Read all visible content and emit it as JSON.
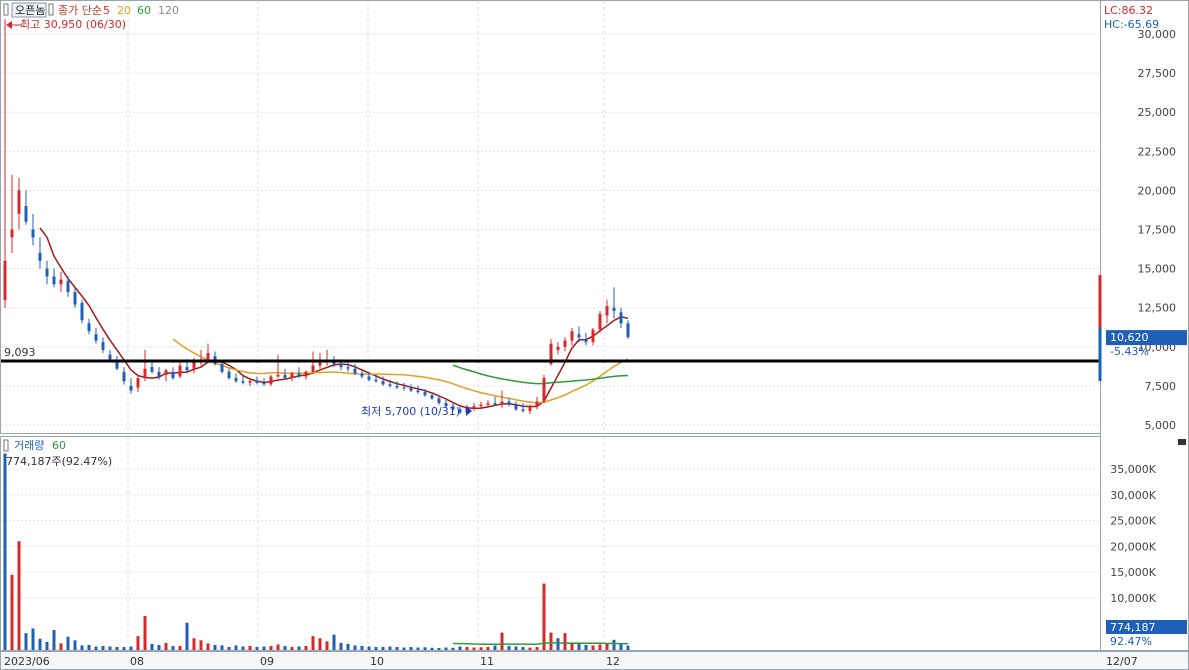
{
  "header": {
    "open_button": "오픈놈",
    "ma_label": "종가 단순",
    "ma_periods": [
      {
        "label": "5",
        "color": "#c0392b"
      },
      {
        "label": "20",
        "color": "#e0a020"
      },
      {
        "label": "60",
        "color": "#2e9b3a"
      },
      {
        "label": "120",
        "color": "#888888"
      }
    ],
    "lc": "LC:86.32",
    "hc": "HC:-65.69"
  },
  "annotations": {
    "high": "최고 30,950 (06/30)",
    "low": "최저 5,700 (10/31)",
    "hline_label": "9,093",
    "current_price": "10,620",
    "current_change": "-5.43%",
    "volume_title": "거래량",
    "volume_ma": "60",
    "volume_info": "774,187주(92.47%)",
    "volume_current": "774,187",
    "volume_pct": "92.47%",
    "date_label": "12/07"
  },
  "colors": {
    "up": "#d42a2a",
    "down": "#1e5fb8",
    "ma5": "#a01818",
    "ma20": "#e0a020",
    "ma60": "#2e9b3a",
    "hline": "#000000",
    "grid": "#dde3ea"
  },
  "chart_data": [
    {
      "type": "candlestick",
      "ylim": [
        4000,
        31000
      ],
      "yticks": [
        "5,000",
        "7,500",
        "10,000",
        "12,500",
        "15,000",
        "17,500",
        "20,000",
        "22,500",
        "25,000",
        "27,500",
        "30,000"
      ],
      "xticks": [
        "2023/06",
        "08",
        "09",
        "10",
        "11",
        "12"
      ],
      "hline": 9093,
      "ohlc": [
        [
          13000,
          30950,
          12500,
          15500
        ],
        [
          17000,
          21000,
          16000,
          17500
        ],
        [
          18500,
          20800,
          17500,
          20000
        ],
        [
          19000,
          20000,
          17800,
          18000
        ],
        [
          17500,
          18500,
          16500,
          17000
        ],
        [
          16000,
          17000,
          15000,
          15500
        ],
        [
          15000,
          15500,
          14000,
          14500
        ],
        [
          14500,
          15000,
          13800,
          14000
        ],
        [
          14000,
          14800,
          13500,
          14300
        ],
        [
          14200,
          14500,
          13200,
          13500
        ],
        [
          13500,
          13800,
          12500,
          12700
        ],
        [
          12800,
          13000,
          11500,
          11700
        ],
        [
          11500,
          11800,
          10800,
          11000
        ],
        [
          10800,
          11200,
          10200,
          10400
        ],
        [
          10300,
          10600,
          9600,
          9800
        ],
        [
          9500,
          9800,
          9000,
          9200
        ],
        [
          9100,
          9400,
          8500,
          8600
        ],
        [
          8400,
          8700,
          7600,
          7800
        ],
        [
          7500,
          8000,
          7000,
          7200
        ],
        [
          7400,
          8200,
          7100,
          8000
        ],
        [
          8000,
          9800,
          7800,
          8600
        ],
        [
          8700,
          9000,
          8300,
          8400
        ],
        [
          8400,
          8700,
          7900,
          8100
        ],
        [
          8200,
          8600,
          7800,
          8500
        ],
        [
          8400,
          8700,
          7900,
          8000
        ],
        [
          8100,
          9000,
          8000,
          8800
        ],
        [
          8700,
          9200,
          8400,
          8500
        ],
        [
          8600,
          9300,
          8300,
          9000
        ],
        [
          9000,
          9800,
          8800,
          9200
        ],
        [
          9200,
          10200,
          9000,
          9600
        ],
        [
          9400,
          9700,
          8800,
          8900
        ],
        [
          8900,
          9100,
          8300,
          8400
        ],
        [
          8400,
          8600,
          7900,
          8000
        ],
        [
          8000,
          8300,
          7700,
          7800
        ],
        [
          7800,
          8100,
          7600,
          7700
        ],
        [
          7700,
          8000,
          7500,
          7800
        ],
        [
          7800,
          8100,
          7600,
          7700
        ],
        [
          7700,
          8000,
          7500,
          7600
        ],
        [
          7600,
          8200,
          7500,
          8100
        ],
        [
          8100,
          9500,
          8000,
          8200
        ],
        [
          8200,
          8600,
          7900,
          8000
        ],
        [
          8000,
          8400,
          7800,
          8300
        ],
        [
          8300,
          8700,
          8000,
          8100
        ],
        [
          8100,
          8500,
          7900,
          8400
        ],
        [
          8400,
          9700,
          8300,
          8800
        ],
        [
          8800,
          9600,
          8600,
          9000
        ],
        [
          9000,
          9800,
          8800,
          9100
        ],
        [
          9100,
          9400,
          8700,
          8900
        ],
        [
          8900,
          9200,
          8500,
          8700
        ],
        [
          8700,
          9000,
          8400,
          8600
        ],
        [
          8600,
          8900,
          8200,
          8300
        ],
        [
          8300,
          8600,
          8000,
          8100
        ],
        [
          8100,
          8400,
          7800,
          7900
        ],
        [
          7900,
          8200,
          7700,
          7800
        ],
        [
          7800,
          8100,
          7500,
          7600
        ],
        [
          7600,
          7900,
          7400,
          7500
        ],
        [
          7500,
          7800,
          7300,
          7400
        ],
        [
          7400,
          7700,
          7200,
          7350
        ],
        [
          7350,
          7600,
          7100,
          7200
        ],
        [
          7200,
          7500,
          7000,
          7100
        ],
        [
          7100,
          7300,
          6800,
          6900
        ],
        [
          6900,
          7100,
          6600,
          6700
        ],
        [
          6700,
          6900,
          6300,
          6400
        ],
        [
          6400,
          6600,
          6100,
          6200
        ],
        [
          6200,
          6400,
          5900,
          6000
        ],
        [
          6000,
          6200,
          5700,
          5800
        ],
        [
          5800,
          6300,
          5700,
          6100
        ],
        [
          6100,
          6400,
          5900,
          6200
        ],
        [
          6200,
          6500,
          6000,
          6300
        ],
        [
          6300,
          6600,
          6100,
          6400
        ],
        [
          6400,
          6800,
          6200,
          6300
        ],
        [
          6300,
          7200,
          6100,
          6500
        ],
        [
          6500,
          6700,
          6200,
          6300
        ],
        [
          6300,
          6500,
          5900,
          6000
        ],
        [
          6000,
          6400,
          5800,
          5900
        ],
        [
          5900,
          6300,
          5700,
          6200
        ],
        [
          6200,
          6800,
          6000,
          6500
        ],
        [
          6500,
          8200,
          6400,
          8000
        ],
        [
          8900,
          10500,
          8800,
          10200
        ],
        [
          9800,
          10300,
          9500,
          10000
        ],
        [
          10000,
          10600,
          9700,
          10400
        ],
        [
          10400,
          11200,
          10100,
          11000
        ],
        [
          10800,
          11300,
          10300,
          10600
        ],
        [
          10500,
          10900,
          10100,
          10300
        ],
        [
          10300,
          11200,
          10100,
          11100
        ],
        [
          11100,
          12300,
          10900,
          12100
        ],
        [
          12000,
          13000,
          11500,
          12600
        ],
        [
          12500,
          13800,
          11800,
          12300
        ],
        [
          12200,
          12500,
          11200,
          11500
        ],
        [
          11500,
          11700,
          10500,
          10620
        ]
      ],
      "ma5_from": 5,
      "ma20_from": 24,
      "ma60_from": 64
    },
    {
      "type": "bar",
      "name": "거래량",
      "ylim": [
        0,
        38000
      ],
      "unit": "K",
      "yticks": [
        "10,000K",
        "15,000K",
        "20,000K",
        "25,000K",
        "30,000K",
        "35,000K"
      ],
      "values": [
        38000,
        14500,
        21000,
        3200,
        4100,
        2100,
        1500,
        3800,
        1200,
        2500,
        1800,
        800,
        900,
        600,
        700,
        600,
        500,
        500,
        600,
        2600,
        6500,
        1100,
        900,
        1300,
        700,
        700,
        5200,
        2200,
        1800,
        1200,
        900,
        800,
        500,
        800,
        600,
        700,
        500,
        600,
        700,
        1000,
        700,
        500,
        600,
        700,
        2600,
        2200,
        1600,
        2900,
        1300,
        1100,
        800,
        700,
        600,
        500,
        500,
        600,
        500,
        400,
        500,
        400,
        450,
        350,
        300,
        400,
        350,
        600,
        500,
        400,
        450,
        500,
        800,
        3300,
        700,
        600,
        500,
        400,
        500,
        12800,
        3300,
        2200,
        3200,
        1400,
        1100,
        900,
        800,
        1000,
        1200,
        1900,
        1100,
        774
      ],
      "up_flags": [
        0,
        1,
        1,
        0,
        0,
        0,
        0,
        0,
        1,
        0,
        0,
        0,
        0,
        0,
        0,
        0,
        0,
        0,
        0,
        1,
        1,
        0,
        0,
        1,
        0,
        1,
        0,
        1,
        1,
        1,
        0,
        0,
        0,
        0,
        0,
        1,
        0,
        0,
        1,
        1,
        0,
        1,
        0,
        1,
        1,
        1,
        1,
        0,
        0,
        0,
        0,
        0,
        0,
        0,
        0,
        0,
        0,
        0,
        0,
        0,
        0,
        0,
        0,
        0,
        0,
        0,
        1,
        1,
        1,
        1,
        0,
        1,
        0,
        0,
        0,
        1,
        1,
        1,
        1,
        0,
        1,
        1,
        0,
        0,
        1,
        1,
        1,
        0,
        0,
        0
      ],
      "ma60_from": 64
    }
  ]
}
